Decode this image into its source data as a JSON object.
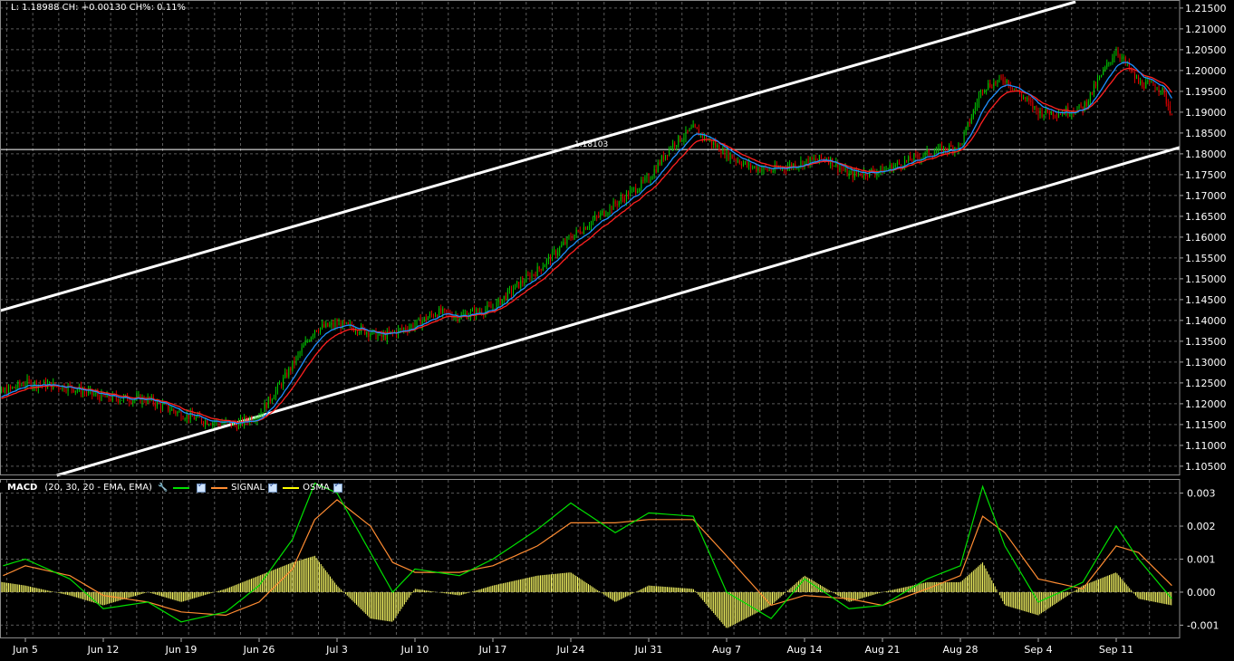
{
  "info_line": "L: 1.18988 CH: +0.00130 CH%: 0.11%",
  "hline_label": "1.18103",
  "macd": {
    "name": "MACD",
    "params": "(20, 30, 20 - EMA, EMA)",
    "legend": [
      {
        "label": "",
        "color": "#00e000"
      },
      {
        "label": "SIGNAL",
        "color": "#ff8c32"
      },
      {
        "label": "OSMA",
        "color": "#ffff00"
      }
    ]
  },
  "colors": {
    "bull": "#00c800",
    "bear": "#e00000",
    "ema_fast": "#1e90ff",
    "ema_slow": "#ff2020",
    "macd": "#00e000",
    "signal": "#ff8c32",
    "osma": "#ffff66",
    "grid": "#5a5a5a",
    "channel": "#ffffff"
  },
  "chart_data": [
    {
      "type": "candlestick",
      "ylim": [
        1.1028,
        1.2165
      ],
      "yticks": [
        "1.21500",
        "1.21000",
        "1.20500",
        "1.20000",
        "1.19500",
        "1.19000",
        "1.18500",
        "1.18000",
        "1.17500",
        "1.17000",
        "1.16500",
        "1.16000",
        "1.15500",
        "1.15000",
        "1.14500",
        "1.14000",
        "1.13500",
        "1.13000",
        "1.12500",
        "1.12000",
        "1.11500",
        "1.11000",
        "1.10500"
      ],
      "x": [
        "Jun 5",
        "Jun 12",
        "Jun 19",
        "Jun 26",
        "Jul 3",
        "Jul 10",
        "Jul 17",
        "Jul 24",
        "Jul 31",
        "Aug 7",
        "Aug 14",
        "Aug 21",
        "Aug 28",
        "Sep 4",
        "Sep 11"
      ],
      "price_path": {
        "x": [
          "Jun 1",
          "Jun 5",
          "Jun 9",
          "Jun 12",
          "Jun 16",
          "Jun 19",
          "Jun 21",
          "Jun 24",
          "Jun 26",
          "Jun 28",
          "Jul 1",
          "Jul 3",
          "Jul 5",
          "Jul 7",
          "Jul 10",
          "Jul 12",
          "Jul 14",
          "Jul 17",
          "Jul 19",
          "Jul 21",
          "Jul 24",
          "Jul 26",
          "Jul 28",
          "Jul 31",
          "Aug 2",
          "Aug 4",
          "Aug 7",
          "Aug 9",
          "Aug 11",
          "Aug 14",
          "Aug 16",
          "Aug 18",
          "Aug 21",
          "Aug 23",
          "Aug 25",
          "Aug 28",
          "Aug 30",
          "Sep 1",
          "Sep 4",
          "Sep 6",
          "Sep 8",
          "Sep 11",
          "Sep 13",
          "Sep 15",
          "Sep 16"
        ],
        "y": [
          1.1205,
          1.125,
          1.124,
          1.1215,
          1.121,
          1.1175,
          1.116,
          1.115,
          1.1175,
          1.125,
          1.138,
          1.139,
          1.138,
          1.136,
          1.139,
          1.142,
          1.141,
          1.143,
          1.148,
          1.152,
          1.16,
          1.164,
          1.168,
          1.174,
          1.182,
          1.186,
          1.18,
          1.177,
          1.176,
          1.178,
          1.179,
          1.175,
          1.176,
          1.178,
          1.18,
          1.182,
          1.196,
          1.198,
          1.19,
          1.19,
          1.191,
          1.205,
          1.197,
          1.196,
          1.1895
        ]
      },
      "ema_fast_label": "EMA (blue)",
      "ema_slow_label": "EMA (red)",
      "horizontal_line": 1.18103,
      "channel_upper": [
        {
          "x": "Jun 1",
          "y": 1.141
        },
        {
          "x": "Sep 8",
          "y": 1.217
        }
      ],
      "channel_lower": [
        {
          "x": "Jun 10",
          "y": 1.1045
        },
        {
          "x": "Sep 16",
          "y": 1.181
        }
      ]
    },
    {
      "type": "line",
      "title": "MACD",
      "ylim": [
        -0.0014,
        0.0034
      ],
      "yticks": [
        "0.003",
        "0.002",
        "0.001",
        "0.000",
        "-0.001"
      ],
      "series": [
        {
          "name": "",
          "x": [
            "Jun 1",
            "Jun 5",
            "Jun 9",
            "Jun 12",
            "Jun 16",
            "Jun 19",
            "Jun 23",
            "Jun 26",
            "Jun 29",
            "Jul 1",
            "Jul 3",
            "Jul 6",
            "Jul 8",
            "Jul 10",
            "Jul 14",
            "Jul 17",
            "Jul 21",
            "Jul 24",
            "Jul 28",
            "Jul 31",
            "Aug 4",
            "Aug 7",
            "Aug 11",
            "Aug 14",
            "Aug 18",
            "Aug 21",
            "Aug 25",
            "Aug 28",
            "Aug 30",
            "Sep 1",
            "Sep 4",
            "Sep 8",
            "Sep 11",
            "Sep 13",
            "Sep 16"
          ],
          "y": [
            0.0006,
            0.001,
            0.0004,
            -0.0005,
            -0.0003,
            -0.0009,
            -0.0006,
            0.0002,
            0.0016,
            0.0033,
            0.003,
            0.0012,
            0.0,
            0.0007,
            0.0005,
            0.001,
            0.0019,
            0.0027,
            0.0018,
            0.0024,
            0.0023,
            0.0,
            -0.0008,
            0.0004,
            -0.0005,
            -0.0004,
            0.0004,
            0.0008,
            0.0032,
            0.0014,
            -0.0003,
            0.0003,
            0.002,
            0.001,
            -0.0002
          ]
        },
        {
          "name": "SIGNAL",
          "x": [
            "Jun 1",
            "Jun 5",
            "Jun 9",
            "Jun 12",
            "Jun 16",
            "Jun 19",
            "Jun 23",
            "Jun 26",
            "Jun 29",
            "Jul 1",
            "Jul 3",
            "Jul 6",
            "Jul 8",
            "Jul 10",
            "Jul 14",
            "Jul 17",
            "Jul 21",
            "Jul 24",
            "Jul 28",
            "Jul 31",
            "Aug 4",
            "Aug 7",
            "Aug 11",
            "Aug 14",
            "Aug 18",
            "Aug 21",
            "Aug 25",
            "Aug 28",
            "Aug 30",
            "Sep 1",
            "Sep 4",
            "Sep 8",
            "Sep 11",
            "Sep 13",
            "Sep 16"
          ],
          "y": [
            0.0002,
            0.0008,
            0.0005,
            -0.0001,
            -0.0003,
            -0.0006,
            -0.0007,
            -0.0003,
            0.0007,
            0.0022,
            0.0028,
            0.002,
            0.0009,
            0.0006,
            0.0006,
            0.0008,
            0.0014,
            0.0021,
            0.0021,
            0.0022,
            0.0022,
            0.0011,
            -0.0004,
            -0.0001,
            -0.0002,
            -0.0004,
            0.0001,
            0.0005,
            0.0023,
            0.0018,
            0.0004,
            0.0001,
            0.0014,
            0.0012,
            0.0002
          ]
        },
        {
          "name": "OSMA",
          "x": [
            "Jun 1",
            "Jun 5",
            "Jun 9",
            "Jun 12",
            "Jun 16",
            "Jun 19",
            "Jun 23",
            "Jun 26",
            "Jun 29",
            "Jul 1",
            "Jul 3",
            "Jul 6",
            "Jul 8",
            "Jul 10",
            "Jul 14",
            "Jul 17",
            "Jul 21",
            "Jul 24",
            "Jul 28",
            "Jul 31",
            "Aug 4",
            "Aug 7",
            "Aug 11",
            "Aug 14",
            "Aug 18",
            "Aug 21",
            "Aug 25",
            "Aug 28",
            "Aug 30",
            "Sep 1",
            "Sep 4",
            "Sep 8",
            "Sep 11",
            "Sep 13",
            "Sep 16"
          ],
          "y": [
            0.0004,
            0.0002,
            -0.0001,
            -0.0004,
            0.0,
            -0.0003,
            0.0001,
            0.0005,
            0.0009,
            0.0011,
            0.0002,
            -0.0008,
            -0.0009,
            0.0001,
            -0.0001,
            0.0002,
            0.0005,
            0.0006,
            -0.0003,
            0.0002,
            0.0001,
            -0.0011,
            -0.0004,
            0.0005,
            -0.0003,
            0.0,
            0.0003,
            0.0003,
            0.0009,
            -0.0004,
            -0.0007,
            0.0002,
            0.0006,
            -0.0002,
            -0.0004
          ]
        }
      ]
    }
  ]
}
